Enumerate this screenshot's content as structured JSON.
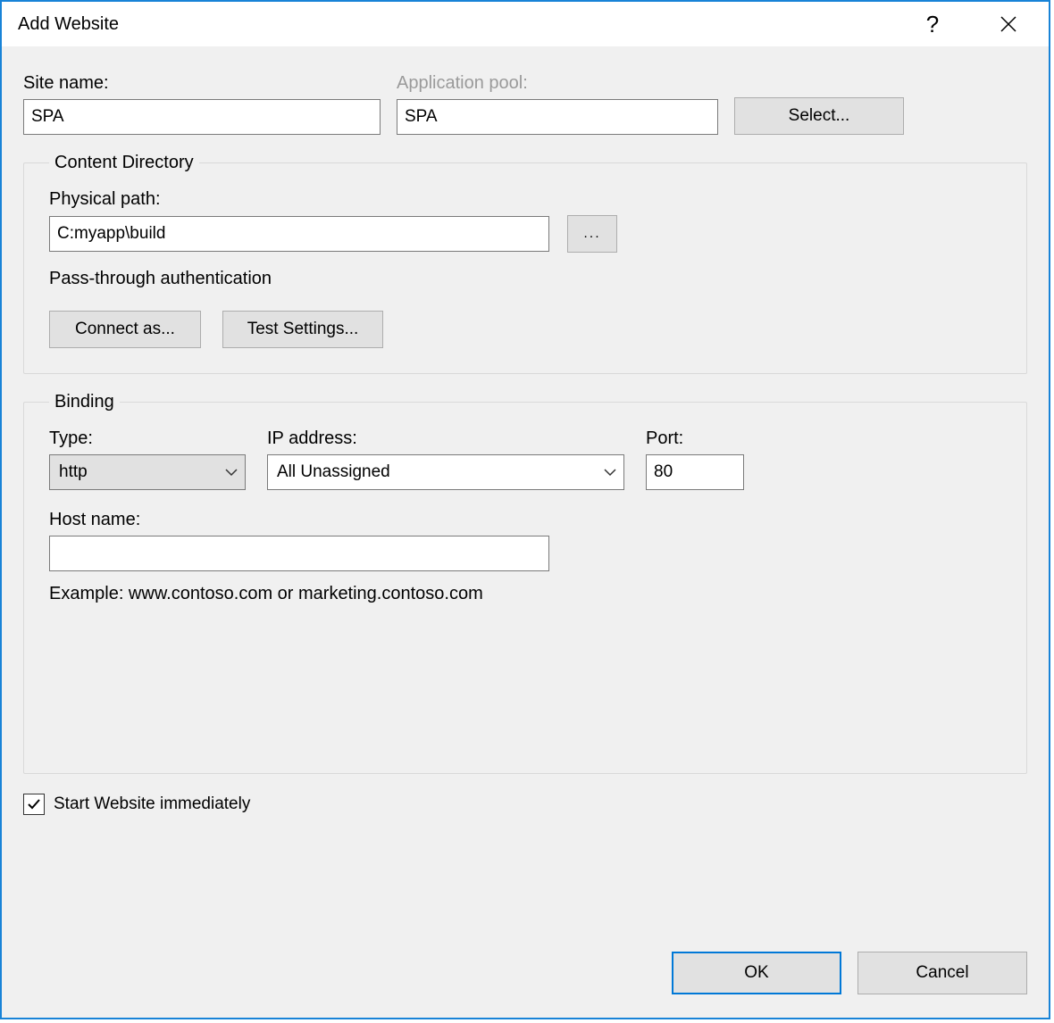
{
  "titlebar": {
    "title": "Add Website",
    "help_icon": "help-icon",
    "close_icon": "close-icon"
  },
  "site": {
    "name_label": "Site name:",
    "name_value": "SPA",
    "app_pool_label": "Application pool:",
    "app_pool_value": "SPA",
    "select_label": "Select..."
  },
  "content_directory": {
    "legend": "Content Directory",
    "physical_path_label": "Physical path:",
    "physical_path_value": "C:myapp\\build",
    "browse_label": "...",
    "passthrough_label": "Pass-through authentication",
    "connect_as_label": "Connect as...",
    "test_settings_label": "Test Settings..."
  },
  "binding": {
    "legend": "Binding",
    "type_label": "Type:",
    "type_value": "http",
    "ip_label": "IP address:",
    "ip_value": "All Unassigned",
    "port_label": "Port:",
    "port_value": "80",
    "host_label": "Host name:",
    "host_value": "",
    "example_text": "Example: www.contoso.com or marketing.contoso.com"
  },
  "start_immediately": {
    "label": "Start Website immediately",
    "checked": true
  },
  "footer": {
    "ok_label": "OK",
    "cancel_label": "Cancel"
  }
}
